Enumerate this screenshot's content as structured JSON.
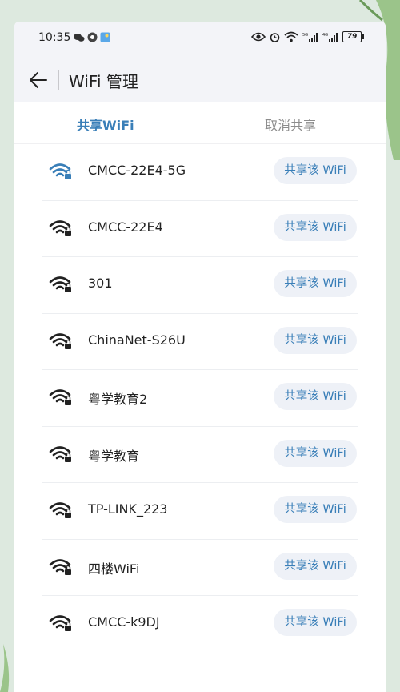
{
  "status_bar": {
    "time": "10:35",
    "battery": "79"
  },
  "header": {
    "title": "WiFi 管理"
  },
  "tabs": [
    {
      "label": "共享WiFi",
      "active": true
    },
    {
      "label": "取消共享",
      "active": false
    }
  ],
  "networks": [
    {
      "ssid": "CMCC-22E4-5G",
      "action": "共享该 WiFi",
      "signal_color": "#3a7fb8"
    },
    {
      "ssid": "CMCC-22E4",
      "action": "共享该 WiFi",
      "signal_color": "#222222"
    },
    {
      "ssid": "301",
      "action": "共享该 WiFi",
      "signal_color": "#222222"
    },
    {
      "ssid": "ChinaNet-S26U",
      "action": "共享该 WiFi",
      "signal_color": "#222222"
    },
    {
      "ssid": "粤学教育2",
      "action": "共享该 WiFi",
      "signal_color": "#222222"
    },
    {
      "ssid": "粤学教育",
      "action": "共享该 WiFi",
      "signal_color": "#222222"
    },
    {
      "ssid": "TP-LINK_223",
      "action": "共享该 WiFi",
      "signal_color": "#222222"
    },
    {
      "ssid": "四楼WiFi",
      "action": "共享该 WiFi",
      "signal_color": "#222222"
    },
    {
      "ssid": "CMCC-k9DJ",
      "action": "共享该 WiFi",
      "signal_color": "#222222"
    }
  ],
  "colors": {
    "accent": "#3a7fb8",
    "inactive_tab": "#8c8c8c",
    "button_bg": "#eef1f7"
  }
}
